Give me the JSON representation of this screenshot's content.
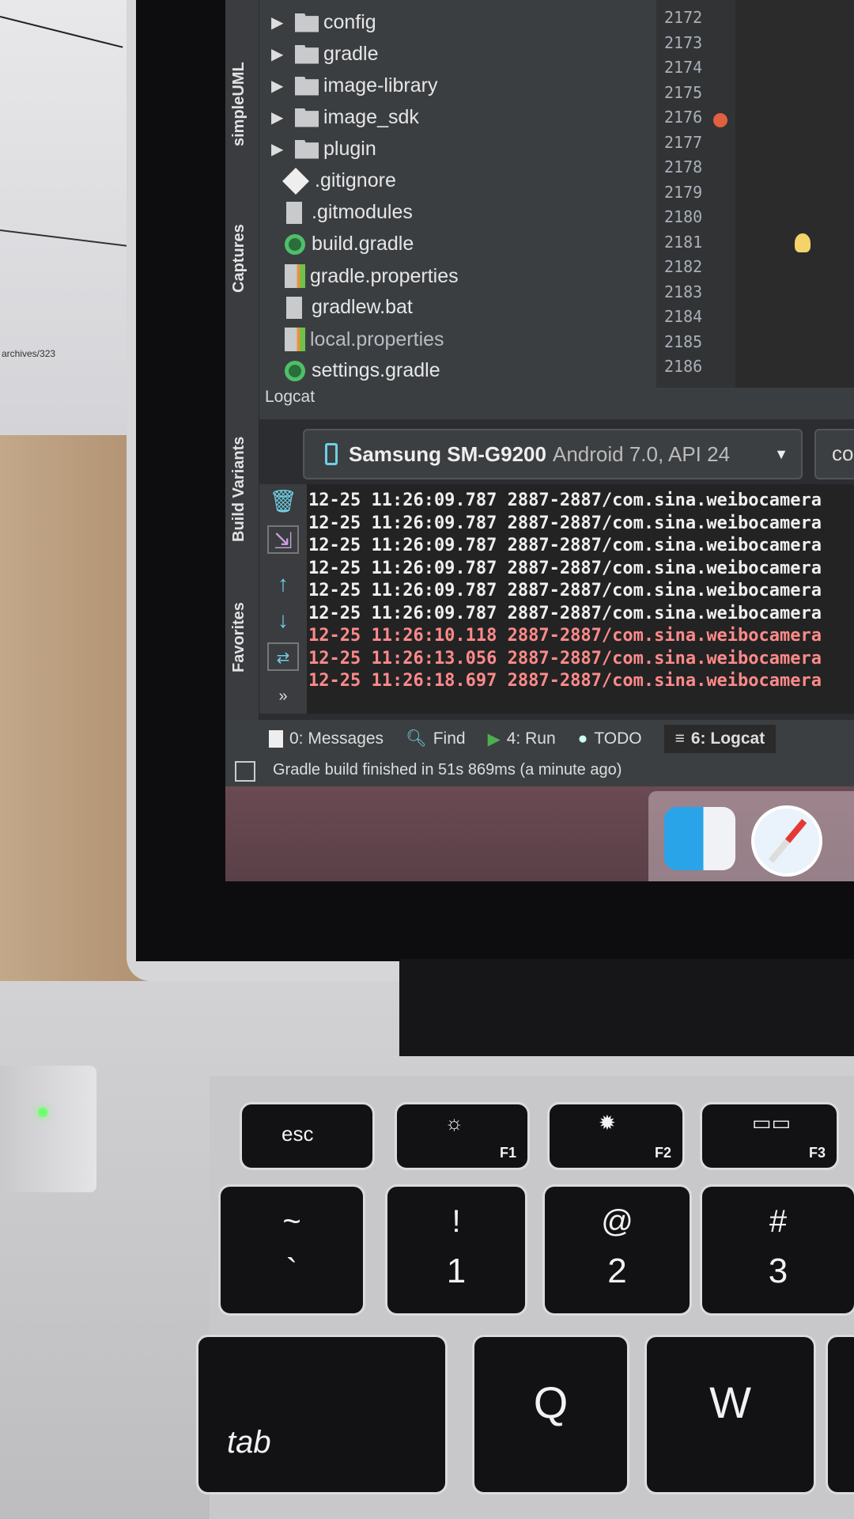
{
  "paper": {
    "text": "archives/323"
  },
  "ide": {
    "side_tabs": [
      "simpleUML",
      "Captures",
      "Build Variants",
      "Favorites"
    ],
    "project_tree": [
      {
        "name": "config",
        "type": "folder"
      },
      {
        "name": "gradle",
        "type": "folder"
      },
      {
        "name": "image-library",
        "type": "folder"
      },
      {
        "name": "image_sdk",
        "type": "folder"
      },
      {
        "name": "plugin",
        "type": "folder"
      },
      {
        "name": ".gitignore",
        "type": "git"
      },
      {
        "name": ".gitmodules",
        "type": "doc"
      },
      {
        "name": "build.gradle",
        "type": "gradle"
      },
      {
        "name": "gradle.properties",
        "type": "props"
      },
      {
        "name": "gradlew.bat",
        "type": "doc"
      },
      {
        "name": "local.properties",
        "type": "props"
      },
      {
        "name": "settings.gradle",
        "type": "gradle"
      }
    ],
    "line_numbers": [
      "2172",
      "2173",
      "2174",
      "2175",
      "2176",
      "2177",
      "2178",
      "2179",
      "2180",
      "2181",
      "2182",
      "2183",
      "2184",
      "2185",
      "2186"
    ],
    "logcat": {
      "title": "Logcat",
      "device_name": "Samsung SM-G9200",
      "device_detail": "Android 7.0, API 24",
      "next_dropdown": "co",
      "lines": [
        {
          "text": "12-25 11:26:09.787 2887-2887/com.sina.weibocamera",
          "level": "info"
        },
        {
          "text": "12-25 11:26:09.787 2887-2887/com.sina.weibocamera",
          "level": "info"
        },
        {
          "text": "12-25 11:26:09.787 2887-2887/com.sina.weibocamera",
          "level": "info"
        },
        {
          "text": "12-25 11:26:09.787 2887-2887/com.sina.weibocamera",
          "level": "info"
        },
        {
          "text": "12-25 11:26:09.787 2887-2887/com.sina.weibocamera",
          "level": "info"
        },
        {
          "text": "12-25 11:26:09.787 2887-2887/com.sina.weibocamera",
          "level": "info"
        },
        {
          "text": "12-25 11:26:10.118 2887-2887/com.sina.weibocamera",
          "level": "error"
        },
        {
          "text": "12-25 11:26:13.056 2887-2887/com.sina.weibocamera",
          "level": "error"
        },
        {
          "text": "12-25 11:26:18.697 2887-2887/com.sina.weibocamera",
          "level": "error"
        }
      ],
      "colors": {
        "info": "#f0f0f0",
        "error": "#ff8a8a"
      }
    },
    "bottom_tabs": [
      "0: Messages",
      "Find",
      "4: Run",
      "TODO",
      "6: Logcat"
    ],
    "active_tab": "6: Logcat",
    "status": "Gradle build finished in 51s 869ms (a minute ago)"
  },
  "keyboard": {
    "row1": [
      {
        "label": "esc"
      },
      {
        "label": "F1",
        "icon": "brightness-down"
      },
      {
        "label": "F2",
        "icon": "brightness-up"
      },
      {
        "label": "F3",
        "icon": "mission-control"
      }
    ],
    "row2": [
      {
        "top": "~",
        "bottom": "`"
      },
      {
        "top": "!",
        "bottom": "1"
      },
      {
        "top": "@",
        "bottom": "2"
      },
      {
        "top": "#",
        "bottom": "3"
      }
    ],
    "row3": [
      {
        "label": "tab"
      },
      {
        "label": "Q"
      },
      {
        "label": "W"
      }
    ]
  }
}
